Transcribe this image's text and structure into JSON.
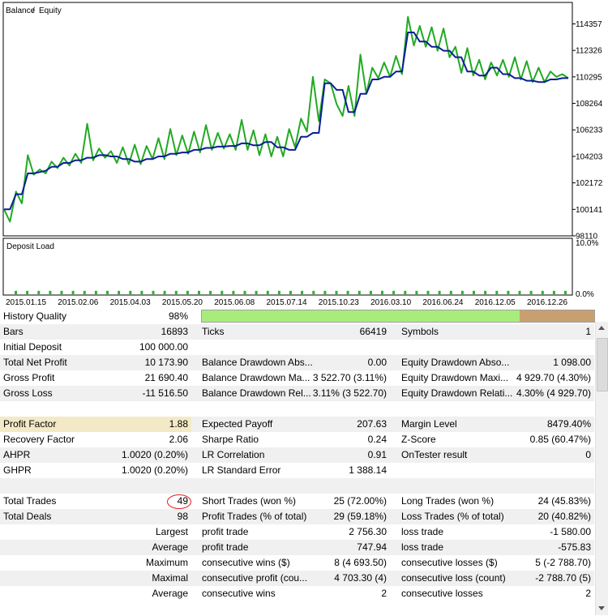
{
  "chart_data": [
    {
      "type": "line",
      "legend": [
        "Balance",
        "Equity"
      ],
      "legend_placement": "top-left",
      "colors": {
        "balance": "#0a1e96",
        "equity": "#22aa22"
      },
      "ytick_labels": [
        "98110",
        "100141",
        "102172",
        "104203",
        "106233",
        "108264",
        "110295",
        "112326",
        "114357"
      ],
      "ylim": [
        98110,
        116000
      ],
      "xtick_labels": [
        "2015.01.15",
        "2015.02.06",
        "2015.04.03",
        "2015.05.20",
        "2015.06.08",
        "2015.07.14",
        "2015.10.23",
        "2016.03.10",
        "2016.06.24",
        "2016.12.05",
        "2016.12.26"
      ],
      "series": [
        {
          "name": "Balance",
          "values": [
            100141,
            100141,
            101300,
            101300,
            102900,
            102900,
            103000,
            103100,
            103400,
            103400,
            103700,
            103700,
            103900,
            103900,
            104100,
            104100,
            104300,
            104300,
            104200,
            104200,
            104000,
            104000,
            103800,
            103800,
            104000,
            104000,
            104200,
            104200,
            104400,
            104400,
            104500,
            104500,
            104700,
            104700,
            104850,
            104850,
            104950,
            104950,
            105000,
            105000,
            105200,
            105200,
            105050,
            105050,
            105300,
            105300,
            104900,
            104900,
            104700,
            104700,
            105700,
            105700,
            106000,
            106000,
            109800,
            109800,
            109300,
            109300,
            107600,
            107600,
            109000,
            109000,
            110100,
            110100,
            110300,
            110300,
            110700,
            110700,
            113700,
            113700,
            113000,
            113000,
            112600,
            112600,
            112300,
            112300,
            111800,
            111800,
            110700,
            110700,
            110400,
            110400,
            111000,
            111000,
            110500,
            110500,
            110200,
            110200,
            110000,
            110000,
            109900,
            109900,
            110100,
            110100,
            110200,
            110200
          ]
        },
        {
          "name": "Equity",
          "values": [
            100141,
            99200,
            101500,
            100600,
            104300,
            102800,
            103200,
            102900,
            103800,
            103300,
            104100,
            103500,
            104400,
            103700,
            106700,
            103900,
            104800,
            104100,
            104600,
            103700,
            104900,
            103600,
            105100,
            103600,
            105000,
            104000,
            105600,
            104000,
            106300,
            104300,
            105800,
            104400,
            106100,
            104500,
            106600,
            104700,
            106000,
            104800,
            105900,
            104700,
            107000,
            104700,
            106200,
            104300,
            105900,
            104200,
            105700,
            104200,
            106300,
            104900,
            107100,
            106100,
            110300,
            106900,
            110100,
            109800,
            108200,
            107300,
            109600,
            107300,
            112000,
            109000,
            111000,
            110200,
            111400,
            110300,
            111900,
            110500,
            114900,
            112700,
            114200,
            112600,
            114100,
            112300,
            114000,
            111800,
            112600,
            110600,
            112500,
            110400,
            111600,
            110100,
            111400,
            110400,
            111600,
            110300,
            111800,
            110100,
            111500,
            109900,
            111000,
            109900,
            110700,
            110300,
            110500,
            110200
          ]
        }
      ]
    },
    {
      "type": "bar",
      "title": "Deposit Load",
      "ytick_labels": [
        "10.0%",
        "0.0%"
      ],
      "ylim": [
        0,
        10
      ],
      "values": [
        0.6,
        0.6,
        0.6,
        0.6,
        0.6,
        0.6,
        0.6,
        0.6,
        0.6,
        0.6,
        0.6,
        0.6,
        0.6,
        0.6,
        0.6,
        0.6,
        0.6,
        0.6,
        0.6,
        0.6,
        0.6,
        0.6,
        0.6,
        0.6,
        0.6,
        0.6,
        0.6,
        0.6,
        0.6,
        0.6,
        0.6,
        0.6,
        0.6,
        0.6,
        0.6,
        0.6,
        0.6,
        0.6,
        0.6,
        0.6,
        0.6,
        0.6,
        0.6,
        0.6,
        0.6,
        0.6,
        0.6,
        0.6,
        0.6
      ]
    }
  ],
  "report": {
    "history_quality": {
      "label": "History Quality",
      "value": "98%",
      "fill_fraction": 0.81
    },
    "rows": [
      [
        {
          "l": "Bars",
          "v": "16893"
        },
        {
          "l": "Ticks",
          "v": "66419"
        },
        {
          "l": "Symbols",
          "v": "1"
        }
      ],
      [
        {
          "l": "Initial Deposit",
          "v": "100 000.00"
        },
        {
          "l": "",
          "v": ""
        },
        {
          "l": "",
          "v": ""
        }
      ],
      [
        {
          "l": "Total Net Profit",
          "v": "10 173.90"
        },
        {
          "l": "Balance Drawdown Abs...",
          "v": "0.00"
        },
        {
          "l": "Equity Drawdown Abso...",
          "v": "1 098.00"
        }
      ],
      [
        {
          "l": "Gross Profit",
          "v": "21 690.40"
        },
        {
          "l": "Balance Drawdown Ma...",
          "v": "3 522.70 (3.11%)"
        },
        {
          "l": "Equity Drawdown Maxi...",
          "v": "4 929.70 (4.30%)"
        }
      ],
      [
        {
          "l": "Gross Loss",
          "v": "-11 516.50"
        },
        {
          "l": "Balance Drawdown Rel...",
          "v": "3.11% (3 522.70)"
        },
        {
          "l": "Equity Drawdown Relati...",
          "v": "4.30% (4 929.70)"
        }
      ],
      [
        {
          "l": "",
          "v": ""
        },
        {
          "l": "",
          "v": ""
        },
        {
          "l": "",
          "v": ""
        }
      ],
      [
        {
          "l": "Profit Factor",
          "v": "1.88"
        },
        {
          "l": "Expected Payoff",
          "v": "207.63"
        },
        {
          "l": "Margin Level",
          "v": "8479.40%"
        }
      ],
      [
        {
          "l": "Recovery Factor",
          "v": "2.06"
        },
        {
          "l": "Sharpe Ratio",
          "v": "0.24"
        },
        {
          "l": "Z-Score",
          "v": "0.85 (60.47%)"
        }
      ],
      [
        {
          "l": "AHPR",
          "v": "1.0020 (0.20%)"
        },
        {
          "l": "LR Correlation",
          "v": "0.91"
        },
        {
          "l": "OnTester result",
          "v": "0"
        }
      ],
      [
        {
          "l": "GHPR",
          "v": "1.0020 (0.20%)"
        },
        {
          "l": "LR Standard Error",
          "v": "1 388.14"
        },
        {
          "l": "",
          "v": ""
        }
      ],
      [
        {
          "l": "",
          "v": ""
        },
        {
          "l": "",
          "v": ""
        },
        {
          "l": "",
          "v": ""
        }
      ],
      [
        {
          "l": "Total Trades",
          "v": "49"
        },
        {
          "l": "Short Trades (won %)",
          "v": "25 (72.00%)"
        },
        {
          "l": "Long Trades (won %)",
          "v": "24 (45.83%)"
        }
      ],
      [
        {
          "l": "Total Deals",
          "v": "98"
        },
        {
          "l": "Profit Trades (% of total)",
          "v": "29 (59.18%)"
        },
        {
          "l": "Loss Trades (% of total)",
          "v": "20 (40.82%)"
        }
      ],
      [
        {
          "l": "",
          "v": "Largest"
        },
        {
          "l": "profit trade",
          "v": "2 756.30"
        },
        {
          "l": "loss trade",
          "v": "-1 580.00"
        }
      ],
      [
        {
          "l": "",
          "v": "Average"
        },
        {
          "l": "profit trade",
          "v": "747.94"
        },
        {
          "l": "loss trade",
          "v": "-575.83"
        }
      ],
      [
        {
          "l": "",
          "v": "Maximum"
        },
        {
          "l": "consecutive wins ($)",
          "v": "8 (4 693.50)"
        },
        {
          "l": "consecutive losses ($)",
          "v": "5 (-2 788.70)"
        }
      ],
      [
        {
          "l": "",
          "v": "Maximal"
        },
        {
          "l": "consecutive profit (cou...",
          "v": "4 703.30 (4)"
        },
        {
          "l": "consecutive loss (count)",
          "v": "-2 788.70 (5)"
        }
      ],
      [
        {
          "l": "",
          "v": "Average"
        },
        {
          "l": "consecutive wins",
          "v": "2"
        },
        {
          "l": "consecutive losses",
          "v": "2"
        }
      ]
    ]
  }
}
